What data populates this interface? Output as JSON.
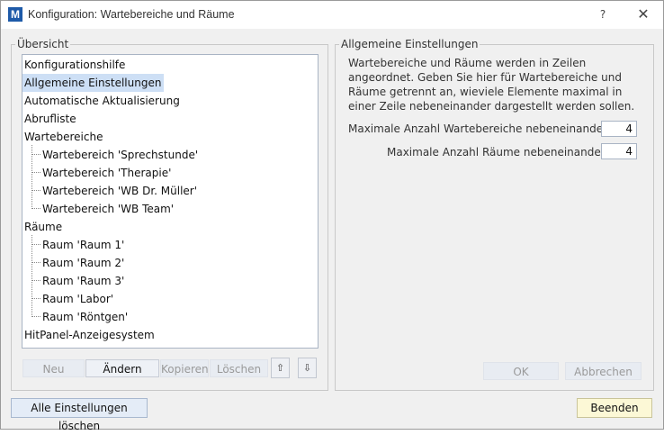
{
  "window": {
    "title": "Konfiguration: Wartebereiche und Räume",
    "help": "?",
    "close": "✕",
    "app_icon": "M"
  },
  "overview": {
    "legend": "Übersicht",
    "items": [
      {
        "label": "Konfigurationshilfe",
        "level": 0
      },
      {
        "label": "Allgemeine Einstellungen",
        "level": 0,
        "selected": true
      },
      {
        "label": "Automatische Aktualisierung",
        "level": 0
      },
      {
        "label": "Abrufliste",
        "level": 0
      },
      {
        "label": "Wartebereiche",
        "level": 0
      },
      {
        "label": "Wartebereich 'Sprechstunde'",
        "level": 1
      },
      {
        "label": "Wartebereich 'Therapie'",
        "level": 1
      },
      {
        "label": "Wartebereich 'WB Dr. Müller'",
        "level": 1
      },
      {
        "label": "Wartebereich 'WB Team'",
        "level": 1
      },
      {
        "label": "Räume",
        "level": 0
      },
      {
        "label": "Raum 'Raum 1'",
        "level": 1
      },
      {
        "label": "Raum 'Raum 2'",
        "level": 1
      },
      {
        "label": "Raum 'Raum 3'",
        "level": 1
      },
      {
        "label": "Raum 'Labor'",
        "level": 1
      },
      {
        "label": "Raum 'Röntgen'",
        "level": 1
      },
      {
        "label": "HitPanel-Anzeigesystem",
        "level": 0
      }
    ],
    "buttons": {
      "new": "Neu",
      "edit": "Ändern",
      "copy": "Kopieren",
      "delete": "Löschen",
      "up": "⇧",
      "down": "⇩"
    }
  },
  "settings": {
    "legend": "Allgemeine Einstellungen",
    "description": "Wartebereiche und Räume werden in Zeilen angeordnet. Geben Sie hier für Wartebereiche und Räume getrennt an, wieviele Elemente maximal in einer Zeile nebeneinander dargestellt werden sollen.",
    "max_waiting_label": "Maximale Anzahl Wartebereiche nebeneinander",
    "max_waiting_value": "4",
    "max_rooms_label": "Maximale Anzahl Räume nebeneinander",
    "max_rooms_value": "4",
    "ok": "OK",
    "cancel": "Abbrechen"
  },
  "footer": {
    "reset_all": "Alle Einstellungen löschen",
    "finish": "Beenden"
  },
  "colors": {
    "selection": "#cddff5",
    "finish_button": "#fcf8d6",
    "app_icon": "#1e5aa8"
  }
}
